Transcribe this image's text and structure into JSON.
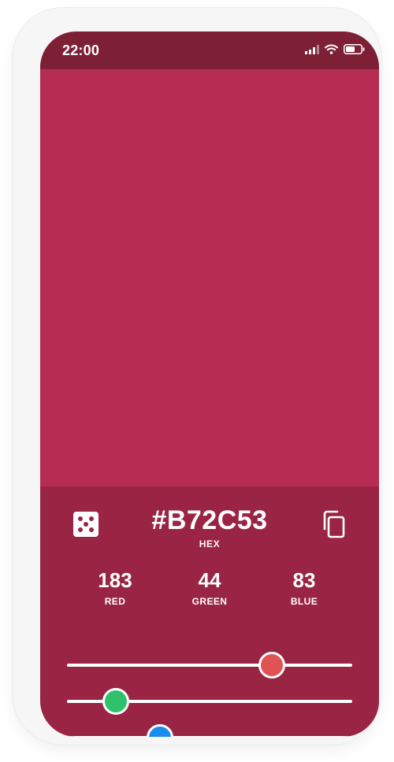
{
  "status_bar": {
    "time": "22:00",
    "icons": [
      "cellular-signal-icon",
      "wifi-icon",
      "battery-icon"
    ]
  },
  "color": {
    "hex": "#B72C53",
    "hex_label": "HEX",
    "swatch_color": "#B72C53",
    "panel_color": "#9A2443",
    "status_bar_color": "#7D2036"
  },
  "toolbar": {
    "random_icon": "dice-icon",
    "copy_icon": "copy-icon"
  },
  "channels": {
    "red": {
      "value": "183",
      "label": "RED"
    },
    "green": {
      "value": "44",
      "label": "GREEN"
    },
    "blue": {
      "value": "83",
      "label": "BLUE"
    }
  },
  "sliders": [
    {
      "name": "red",
      "value": 183,
      "max": 255,
      "thumb_color": "#E05353"
    },
    {
      "name": "green",
      "value": 44,
      "max": 255,
      "thumb_color": "#2EC26A"
    },
    {
      "name": "blue",
      "value": 83,
      "max": 255,
      "thumb_color": "#1A8CF0"
    }
  ]
}
